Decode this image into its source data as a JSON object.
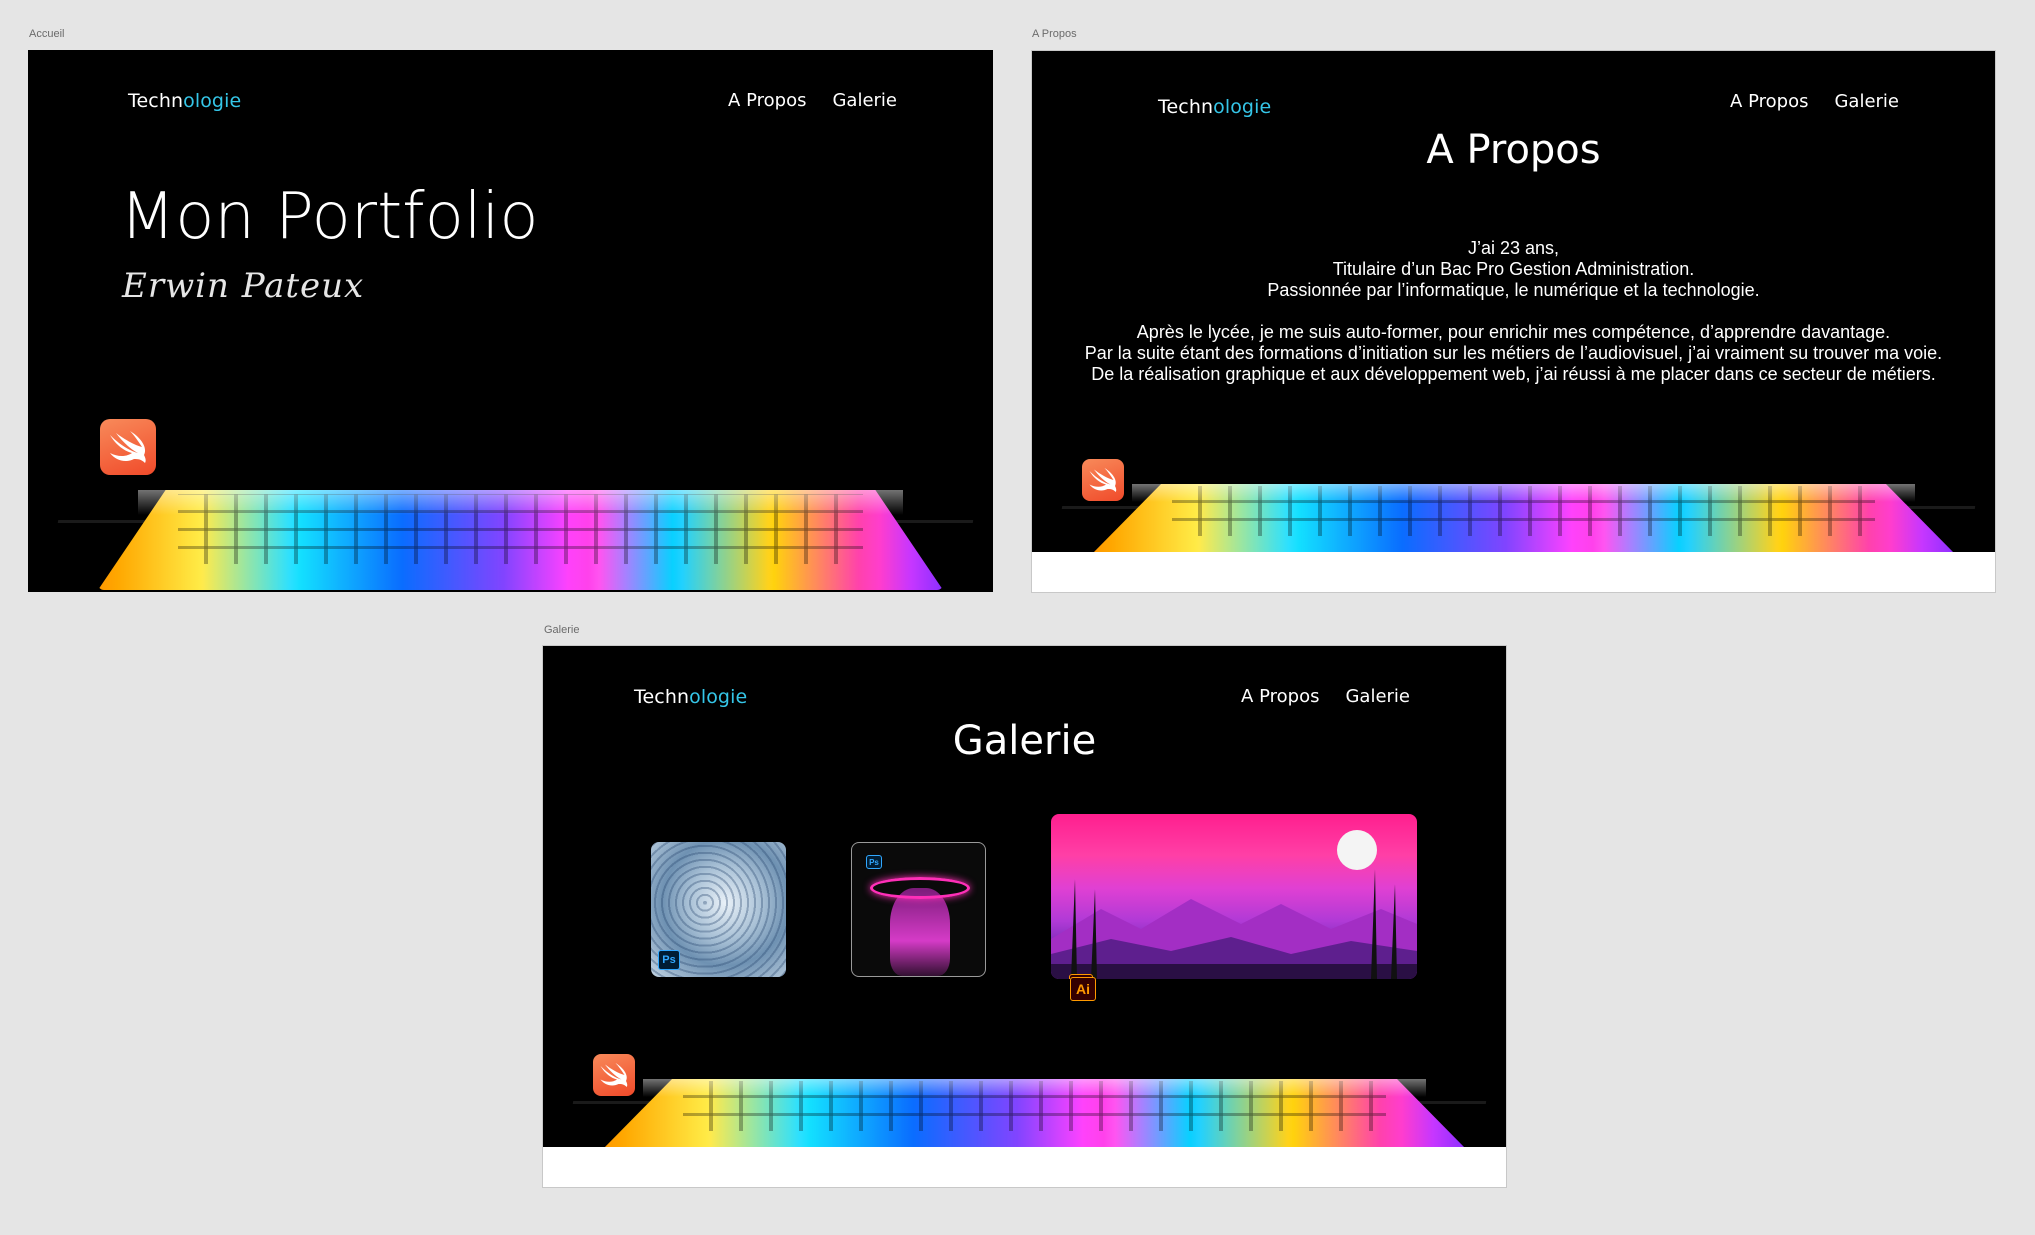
{
  "frames": {
    "accueil": {
      "label": "Accueil",
      "logo": {
        "part1": "Techn",
        "part2": "ologie"
      },
      "nav": [
        "A Propos",
        "Galerie"
      ],
      "title": "Mon Portfolio",
      "subtitle": "Erwin Pateux"
    },
    "apropos": {
      "label": "A Propos",
      "logo": {
        "part1": "Techn",
        "part2": "ologie"
      },
      "nav": [
        "A Propos",
        "Galerie"
      ],
      "title": "A Propos",
      "paragraph1": [
        "J’ai 23 ans,",
        "Titulaire d’un Bac Pro Gestion Administration.",
        "Passionnée  par l’informatique, le numérique et la technologie."
      ],
      "paragraph2": [
        "Après le lycée, je me suis auto-former, pour enrichir mes compétence, d’apprendre davantage.",
        "Par la suite étant des formations d’initiation sur les métiers de l’audiovisuel, j’ai vraiment su trouver ma voie.",
        "De la réalisation graphique et aux développement web, j’ai réussi à me placer dans ce secteur de métiers."
      ]
    },
    "galerie": {
      "label": "Galerie",
      "logo": {
        "part1": "Techn",
        "part2": "ologie"
      },
      "nav": [
        "A Propos",
        "Galerie"
      ],
      "title": "Galerie",
      "badges": {
        "ps": "Ps",
        "ai": "Ai"
      }
    }
  },
  "colors": {
    "accent": "#35c6e8",
    "background": "#000000",
    "canvas": "#e5e5e5"
  },
  "icons": [
    "swift-icon",
    "photoshop-icon",
    "illustrator-icon"
  ]
}
